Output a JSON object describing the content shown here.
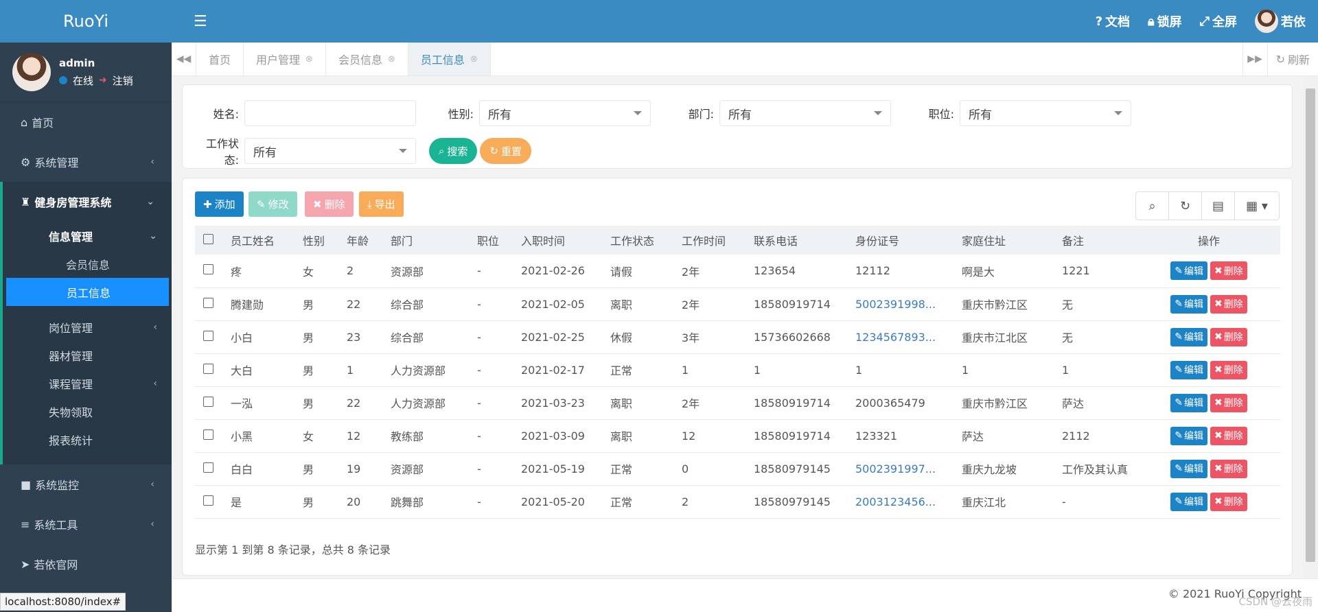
{
  "app": {
    "logo": "RuoYi"
  },
  "user": {
    "name": "admin",
    "status": "在线",
    "logout": "注销",
    "top_name": "若依"
  },
  "topbar": {
    "docs": "文档",
    "lock": "锁屏",
    "fullscreen": "全屏"
  },
  "sidebar": {
    "home": "首页",
    "system": "系统管理",
    "gym": "健身房管理系统",
    "info_mgmt": "信息管理",
    "member_info": "会员信息",
    "staff_info": "员工信息",
    "post_mgmt": "岗位管理",
    "equipment": "器材管理",
    "course": "课程管理",
    "lost_found": "失物领取",
    "report": "报表统计",
    "monitor": "系统监控",
    "tools": "系统工具",
    "official": "若依官网"
  },
  "tabs": [
    {
      "label": "首页"
    },
    {
      "label": "用户管理"
    },
    {
      "label": "会员信息"
    },
    {
      "label": "员工信息"
    }
  ],
  "refresh": "刷新",
  "search": {
    "name_label": "姓名:",
    "gender_label": "性别:",
    "dept_label": "部门:",
    "post_label": "职位:",
    "status_label": "工作状态:",
    "all": "所有",
    "search_btn": "搜索",
    "reset_btn": "重置"
  },
  "toolbar": {
    "add": "添加",
    "edit": "修改",
    "delete": "删除",
    "export": "导出"
  },
  "table": {
    "headers": [
      "员工姓名",
      "性别",
      "年龄",
      "部门",
      "职位",
      "入职时间",
      "工作状态",
      "工作时间",
      "联系电话",
      "身份证号",
      "家庭住址",
      "备注",
      "操作"
    ],
    "rows": [
      [
        "疼",
        "女",
        "2",
        "资源部",
        "-",
        "2021-02-26",
        "请假",
        "2年",
        "123654",
        "12112",
        "啊是大",
        "1221"
      ],
      [
        "腾建勋",
        "男",
        "22",
        "综合部",
        "-",
        "2021-02-05",
        "离职",
        "2年",
        "18580919714",
        "5002391998...",
        "重庆市黔江区",
        "无"
      ],
      [
        "小白",
        "男",
        "23",
        "综合部",
        "-",
        "2021-02-25",
        "休假",
        "3年",
        "15736602668",
        "1234567893...",
        "重庆市江北区",
        "无"
      ],
      [
        "大白",
        "男",
        "1",
        "人力资源部",
        "-",
        "2021-02-17",
        "正常",
        "1",
        "1",
        "1",
        "1",
        "1"
      ],
      [
        "一泓",
        "男",
        "22",
        "人力资源部",
        "-",
        "2021-03-23",
        "离职",
        "2年",
        "18580919714",
        "2000365479",
        "重庆市黔江区",
        "萨达"
      ],
      [
        "小黑",
        "女",
        "12",
        "教练部",
        "-",
        "2021-03-09",
        "离职",
        "12",
        "18580919714",
        "123321",
        "萨达",
        "2112"
      ],
      [
        "白白",
        "男",
        "19",
        "资源部",
        "-",
        "2021-05-19",
        "正常",
        "0",
        "18580979145",
        "5002391997...",
        "重庆九龙坡",
        "工作及其认真"
      ],
      [
        "是",
        "男",
        "20",
        "跳舞部",
        "-",
        "2021-05-20",
        "正常",
        "2",
        "18580979145",
        "2003123456...",
        "重庆江北",
        "-"
      ]
    ],
    "edit_label": "编辑",
    "delete_label": "删除"
  },
  "pager": "显示第 1 到第 8 条记录，总共 8 条记录",
  "footer": "© 2021 RuoYi Copyright",
  "statusbar": "localhost:8080/index#",
  "watermark": "CSDN @云夜雨",
  "colors": {
    "primary": "#3a8bc2",
    "sidebar": "#2f4050",
    "active": "#1890ff",
    "green": "#1ab394",
    "orange": "#f8ac59",
    "danger": "#ed5565"
  }
}
